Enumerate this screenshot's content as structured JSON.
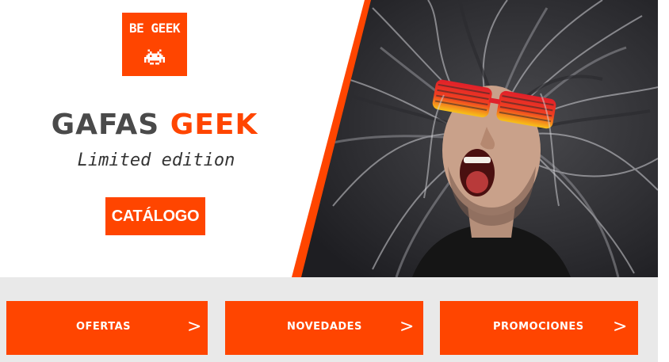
{
  "brand": {
    "logo_text": "BE GEEK",
    "logo_icon": "space-invader-icon",
    "accent_color": "#ff4500"
  },
  "hero": {
    "title_part1": "GAFAS",
    "title_part2": "GEEK",
    "subtitle": "Limited edition",
    "cta_label": "CATÁLOGO",
    "photo": "man-with-wild-hair-and-shutter-glasses-photo"
  },
  "nav": {
    "items": [
      {
        "label": "OFERTAS",
        "chevron": ">"
      },
      {
        "label": "NOVEDADES",
        "chevron": ">"
      },
      {
        "label": "PROMOCIONES",
        "chevron": ">"
      }
    ]
  }
}
